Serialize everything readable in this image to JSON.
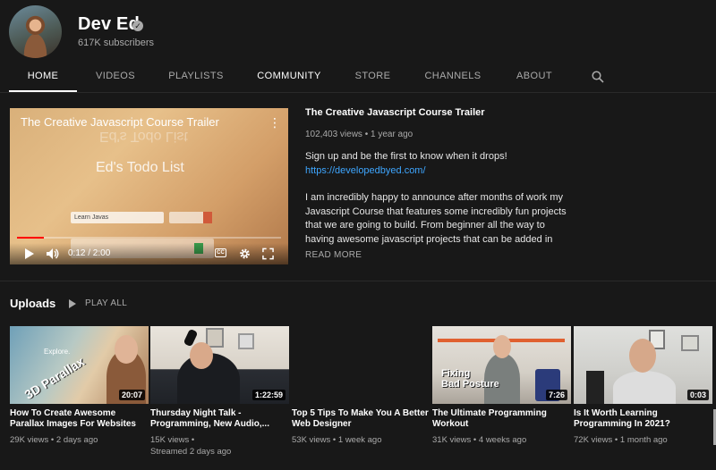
{
  "channel": {
    "name": "Dev Ed",
    "subscribers": "617K subscribers",
    "verified_icon": "check-circle-icon"
  },
  "tabs": [
    {
      "label": "HOME",
      "active": true
    },
    {
      "label": "VIDEOS"
    },
    {
      "label": "PLAYLISTS"
    },
    {
      "label": "COMMUNITY"
    },
    {
      "label": "STORE"
    },
    {
      "label": "CHANNELS"
    },
    {
      "label": "ABOUT"
    }
  ],
  "featured": {
    "player_title": "The Creative Javascript Course Trailer",
    "overlay_text": "Ed's Todo List",
    "input_text": "Learn Javas",
    "time": "0:12 / 2:00",
    "progress": 0.1,
    "cc_label": "CC",
    "title": "The Creative Javascript Course Trailer",
    "meta": "102,403 views • 1 year ago",
    "desc_line1": "Sign up and be the first to know when it drops!",
    "desc_link": "https://developedbyed.com/",
    "desc_para": "I am incredibly happy to announce after months of work my Javascript Course that features some incredibly fun projects that we are going to build. From beginner all the way to having awesome javascript projects that can be added in your portfolio",
    "read_more": "READ MORE"
  },
  "uploads": {
    "title": "Uploads",
    "play_all": "PLAY ALL",
    "videos": [
      {
        "title": "How To Create Awesome Parallax Images For Websites",
        "meta": "29K views • 2 days ago",
        "meta2": "",
        "duration": "20:07",
        "thumb_text": "3D Parallax",
        "thumb_sub": "Explore."
      },
      {
        "title": "Thursday Night Talk - Programming, New Audio,...",
        "meta": "15K views •",
        "meta2": "Streamed 2 days ago",
        "duration": "1:22:59"
      },
      {
        "title": "Top 5 Tips To Make You A Better Web Designer",
        "meta": "53K views • 1 week ago",
        "meta2": ""
      },
      {
        "title": "The Ultimate Programming Workout",
        "meta": "31K views • 4 weeks ago",
        "meta2": "",
        "duration": "7:26",
        "thumb_text1": "Fixing",
        "thumb_text2": "Bad Posture"
      },
      {
        "title": "Is It Worth Learning Programming In 2021?",
        "meta": "72K views • 1 month ago",
        "meta2": "",
        "duration": "0:03"
      }
    ]
  }
}
